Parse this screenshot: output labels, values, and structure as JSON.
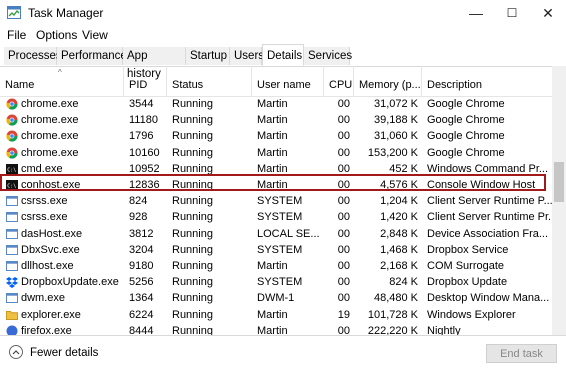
{
  "window": {
    "title": "Task Manager",
    "controls": [
      "—",
      "☐",
      "✕"
    ]
  },
  "menu": [
    "File",
    "Options",
    "View"
  ],
  "tabs": [
    {
      "label": "Processes",
      "active": false
    },
    {
      "label": "Performance",
      "active": false
    },
    {
      "label": "App history",
      "active": false
    },
    {
      "label": "Startup",
      "active": false
    },
    {
      "label": "Users",
      "active": false
    },
    {
      "label": "Details",
      "active": true
    },
    {
      "label": "Services",
      "active": false
    }
  ],
  "columns": [
    "Name",
    "PID",
    "Status",
    "User name",
    "CPU",
    "Memory (p...",
    "Description"
  ],
  "rows": [
    {
      "name": "chrome.exe",
      "icon": "chrome-icon",
      "pid": "3544",
      "status": "Running",
      "user": "Martin",
      "cpu": "00",
      "memory": "31,072 K",
      "description": "Google Chrome"
    },
    {
      "name": "chrome.exe",
      "icon": "chrome-icon",
      "pid": "11180",
      "status": "Running",
      "user": "Martin",
      "cpu": "00",
      "memory": "39,188 K",
      "description": "Google Chrome"
    },
    {
      "name": "chrome.exe",
      "icon": "chrome-icon",
      "pid": "1796",
      "status": "Running",
      "user": "Martin",
      "cpu": "00",
      "memory": "31,060 K",
      "description": "Google Chrome"
    },
    {
      "name": "chrome.exe",
      "icon": "chrome-icon",
      "pid": "10160",
      "status": "Running",
      "user": "Martin",
      "cpu": "00",
      "memory": "153,200 K",
      "description": "Google Chrome"
    },
    {
      "name": "cmd.exe",
      "icon": "console-icon",
      "pid": "10952",
      "status": "Running",
      "user": "Martin",
      "cpu": "00",
      "memory": "452 K",
      "description": "Windows Command Pr..."
    },
    {
      "name": "conhost.exe",
      "icon": "console-icon",
      "pid": "12836",
      "status": "Running",
      "user": "Martin",
      "cpu": "00",
      "memory": "4,576 K",
      "description": "Console Window Host"
    },
    {
      "name": "csrss.exe",
      "icon": "window-icon",
      "pid": "824",
      "status": "Running",
      "user": "SYSTEM",
      "cpu": "00",
      "memory": "1,204 K",
      "description": "Client Server Runtime P..."
    },
    {
      "name": "csrss.exe",
      "icon": "window-icon",
      "pid": "928",
      "status": "Running",
      "user": "SYSTEM",
      "cpu": "00",
      "memory": "1,420 K",
      "description": "Client Server Runtime Pr..."
    },
    {
      "name": "dasHost.exe",
      "icon": "window-icon",
      "pid": "3812",
      "status": "Running",
      "user": "LOCAL SE...",
      "cpu": "00",
      "memory": "2,848 K",
      "description": "Device Association Fra..."
    },
    {
      "name": "DbxSvc.exe",
      "icon": "window-icon",
      "pid": "3204",
      "status": "Running",
      "user": "SYSTEM",
      "cpu": "00",
      "memory": "1,468 K",
      "description": "Dropbox Service"
    },
    {
      "name": "dllhost.exe",
      "icon": "window-icon",
      "pid": "9180",
      "status": "Running",
      "user": "Martin",
      "cpu": "00",
      "memory": "2,168 K",
      "description": "COM Surrogate"
    },
    {
      "name": "DropboxUpdate.exe",
      "icon": "dropbox-icon",
      "pid": "5256",
      "status": "Running",
      "user": "SYSTEM",
      "cpu": "00",
      "memory": "824 K",
      "description": "Dropbox Update"
    },
    {
      "name": "dwm.exe",
      "icon": "window-icon",
      "pid": "1364",
      "status": "Running",
      "user": "DWM-1",
      "cpu": "00",
      "memory": "48,480 K",
      "description": "Desktop Window Mana..."
    },
    {
      "name": "explorer.exe",
      "icon": "folder-icon",
      "pid": "6224",
      "status": "Running",
      "user": "Martin",
      "cpu": "19",
      "memory": "101,728 K",
      "description": "Windows Explorer"
    },
    {
      "name": "firefox.exe",
      "icon": "firefox-icon",
      "pid": "8444",
      "status": "Running",
      "user": "Martin",
      "cpu": "00",
      "memory": "222,220 K",
      "description": "Nightly"
    }
  ],
  "footer": {
    "fewer_details": "Fewer details",
    "end_task": "End task"
  }
}
